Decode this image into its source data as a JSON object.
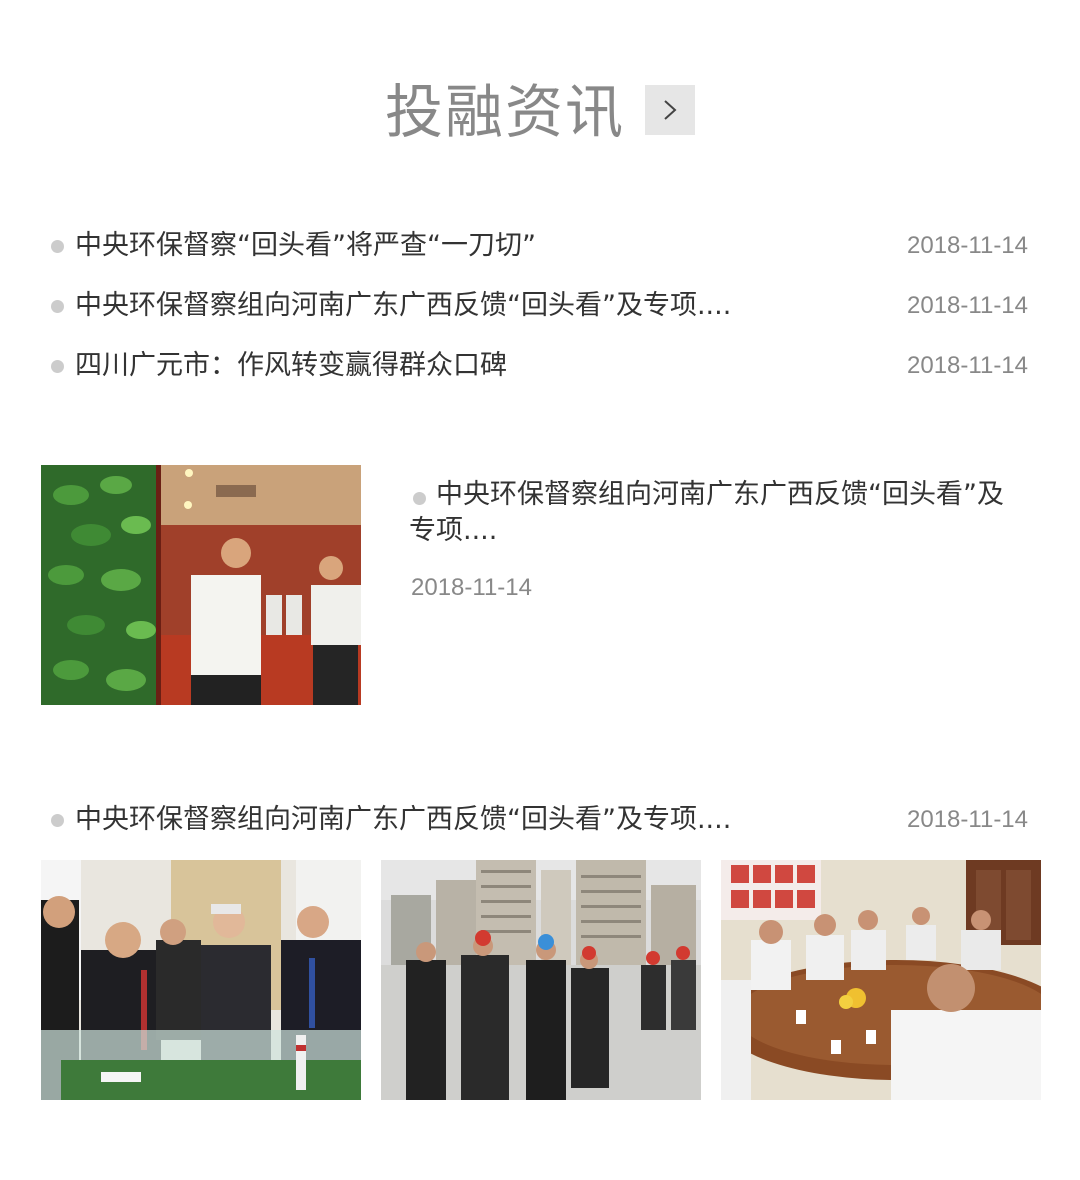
{
  "section": {
    "title": "投融资讯",
    "more_icon": "chevron-right-icon"
  },
  "news": [
    {
      "title": "中央环保督察“回头看”将严查“一刀切”",
      "date": "2018-11-14"
    },
    {
      "title": "中央环保督察组向河南广东广西反馈“回头看”及专项....",
      "date": "2018-11-14"
    },
    {
      "title": "四川广元市：作风转变赢得群众口碑",
      "date": "2018-11-14"
    }
  ],
  "feature": {
    "title": "中央环保督察组向河南广东广西反馈“回头看”及专项....",
    "date": "2018-11-14",
    "photo": "photo-ribbon-cutting"
  },
  "gallery": {
    "title": "中央环保督察组向河南广东广西反馈“回头看”及专项....",
    "date": "2018-11-14",
    "photos": [
      "photo-model-viewing",
      "photo-site-inspection",
      "photo-meeting"
    ]
  },
  "colors": {
    "title": "#888888",
    "text": "#333333",
    "date": "#888888",
    "bullet": "#cccccc",
    "button_bg": "#e6e6e6"
  }
}
